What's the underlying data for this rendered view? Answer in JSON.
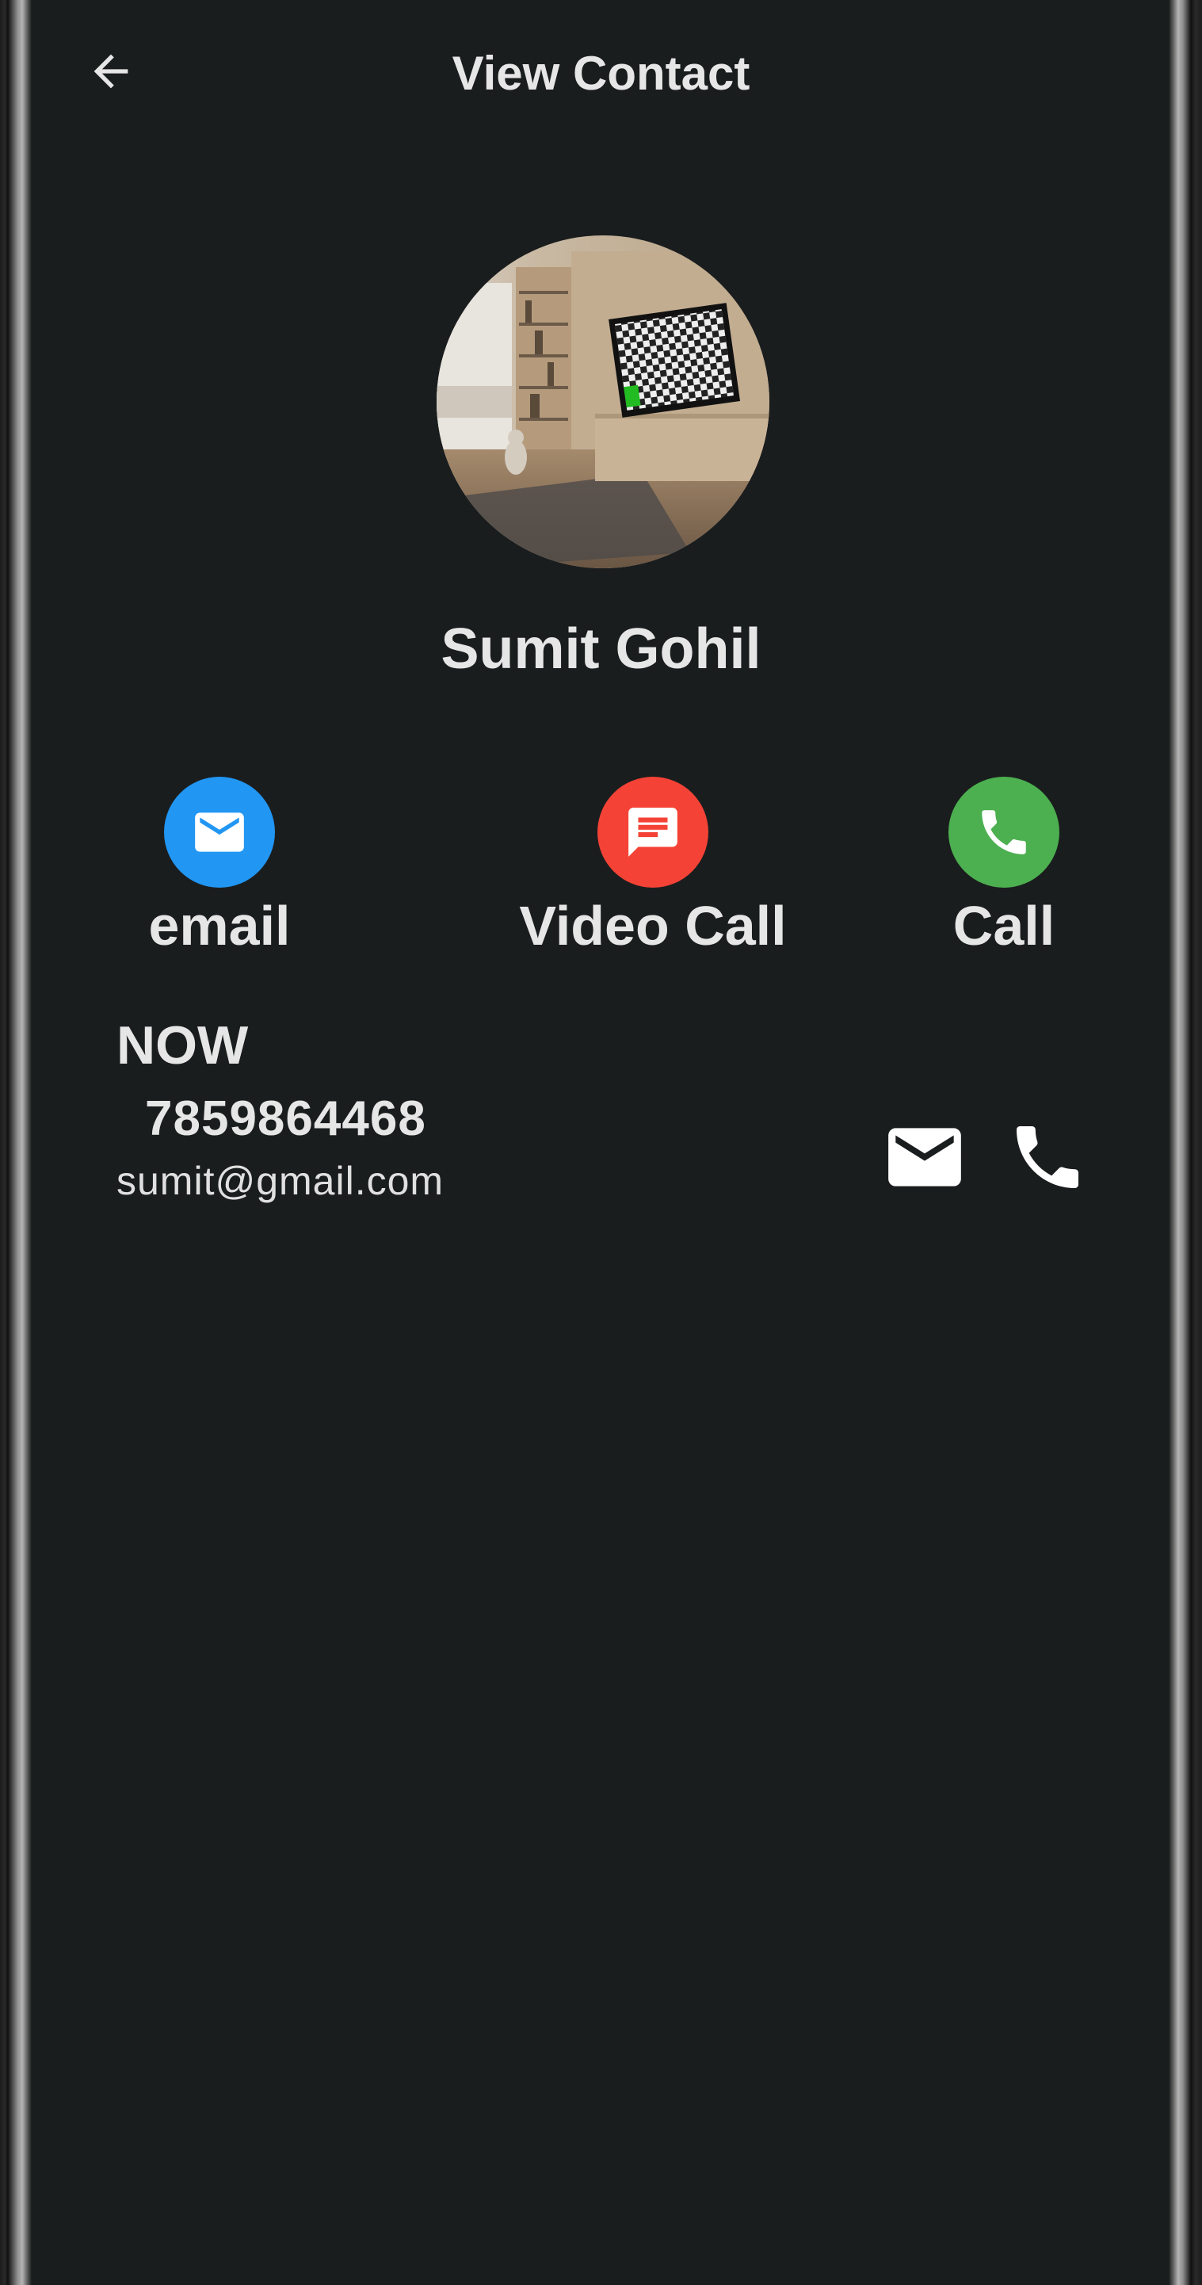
{
  "appbar": {
    "title": "View Contact",
    "back_icon": "arrow-back-icon"
  },
  "contact": {
    "name": "Sumit Gohil",
    "avatar": "living-room-tv-photo"
  },
  "actions": [
    {
      "label": "email",
      "icon": "mail-icon",
      "color": "#2196F3"
    },
    {
      "label": "Video Call",
      "icon": "message-icon",
      "color": "#F44336"
    },
    {
      "label": "Call",
      "icon": "phone-icon",
      "color": "#4CAF50"
    }
  ],
  "detail": {
    "tag": "NOW",
    "phone": "7859864468",
    "email": "sumit@gmail.com",
    "email_icon": "mail-icon",
    "phone_icon": "phone-icon"
  },
  "colors": {
    "background": "#1a1d1e",
    "text": "#e6e6e6"
  }
}
